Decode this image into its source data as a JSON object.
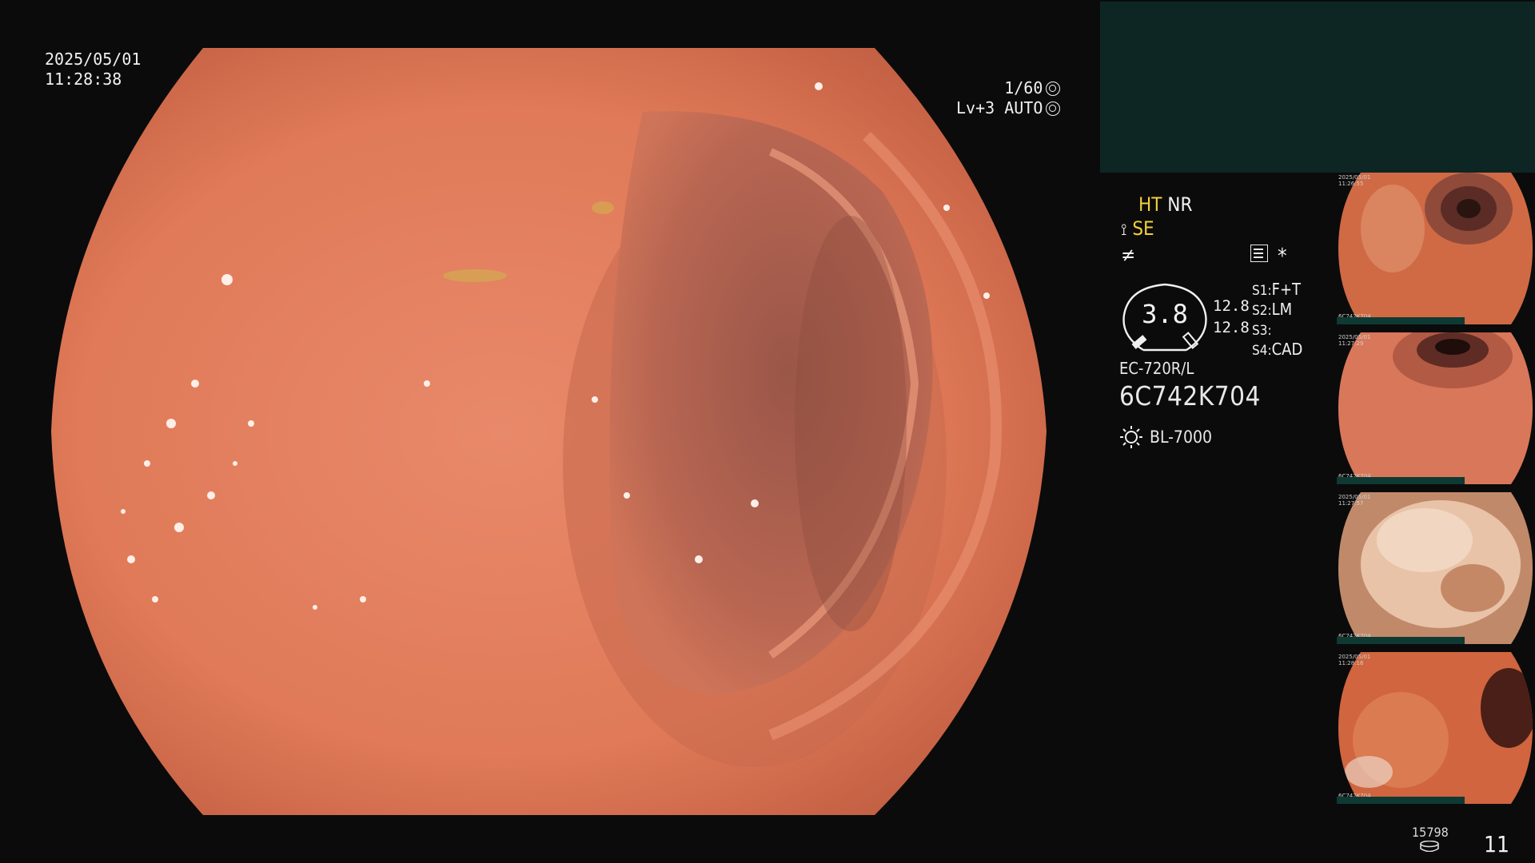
{
  "osd": {
    "date": "2025/05/01",
    "time": "11:28:38",
    "shutter": "1/60",
    "level": "Lv+3 AUTO"
  },
  "settings": {
    "ht": "HT",
    "nr": "NR",
    "se": "SE",
    "zoom": "3.8",
    "val_top": "12.8",
    "val_bottom": "12.8",
    "s1_label": "S1:",
    "s1_value": "F+T",
    "s2_label": "S2:",
    "s2_value": "LM",
    "s3_label": "S3:",
    "s3_value": "",
    "s4_label": "S4:",
    "s4_value": "CAD",
    "scope_model": "EC-720R/L",
    "scope_serial": "6C742K704",
    "light_source": "BL-7000"
  },
  "thumbnails": [
    {
      "date": "2025/05/01",
      "time": "11:26:55",
      "serial": "6C742K704"
    },
    {
      "date": "2025/05/01",
      "time": "11:27:29",
      "serial": "6C742K704"
    },
    {
      "date": "2025/05/01",
      "time": "11:27:57",
      "serial": "6C742K704"
    },
    {
      "date": "2025/05/01",
      "time": "11:28:16",
      "serial": "6C742K704"
    }
  ],
  "footer": {
    "count": "15798",
    "page": "11"
  },
  "colors": {
    "background": "#0b0b0b",
    "panel": "#0e2623",
    "highlight": "#f2cf3a",
    "mucosa": "#e07a58"
  },
  "icons": [
    "shutter-icon",
    "auto-iris-icon",
    "structure-enhance-icon",
    "freeze-icon",
    "record-menu-icon",
    "asterisk-icon",
    "zoom-gauge-icon",
    "lamp-icon",
    "disk-icon"
  ]
}
